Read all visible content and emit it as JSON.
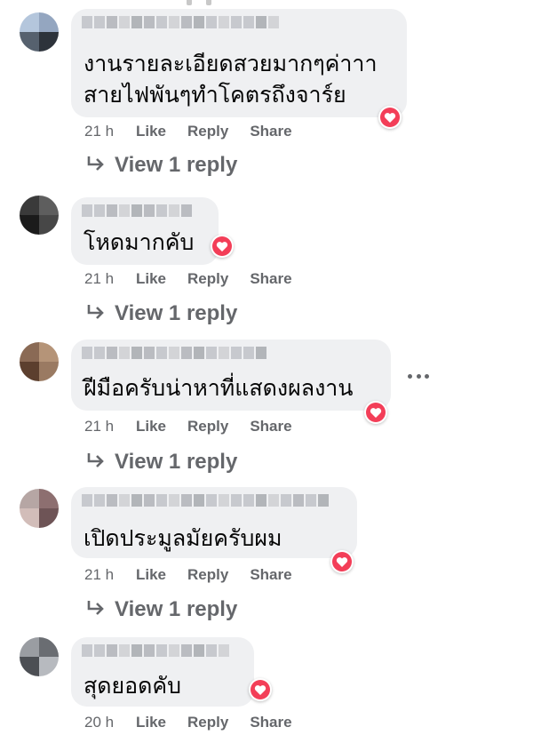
{
  "colors": {
    "bubble": "#eff0f2",
    "action_text": "#65676b",
    "comment_text": "#050505",
    "love_reaction": "#f33e58"
  },
  "icons": {
    "reaction": "love-reaction-icon",
    "reply": "reply-arrow-icon",
    "more": "more-options-icon"
  },
  "labels": {
    "like": "Like",
    "reply": "Reply",
    "share": "Share"
  },
  "comments": [
    {
      "text_lines": [
        "งานรายละเอียดสวยมากๆค่าาา",
        "สายไฟพันๆทำโคตรถึงจาร์ย"
      ],
      "time": "21 h",
      "view_replies": "View 1 reply",
      "reaction": "love"
    },
    {
      "text_lines": [
        "โหดมากคับ"
      ],
      "time": "21 h",
      "view_replies": "View 1 reply",
      "reaction": "love"
    },
    {
      "text_lines": [
        "ฝีมือครับน่าหาที่แสดงผลงาน"
      ],
      "time": "21 h",
      "view_replies": "View 1 reply",
      "reaction": "love"
    },
    {
      "text_lines": [
        "เปิดประมูลมัยครับผม"
      ],
      "time": "21 h",
      "view_replies": "View 1 reply",
      "reaction": "love"
    },
    {
      "text_lines": [
        "สุดยอดคับ"
      ],
      "time": "20 h",
      "view_replies": "",
      "reaction": "love"
    }
  ]
}
